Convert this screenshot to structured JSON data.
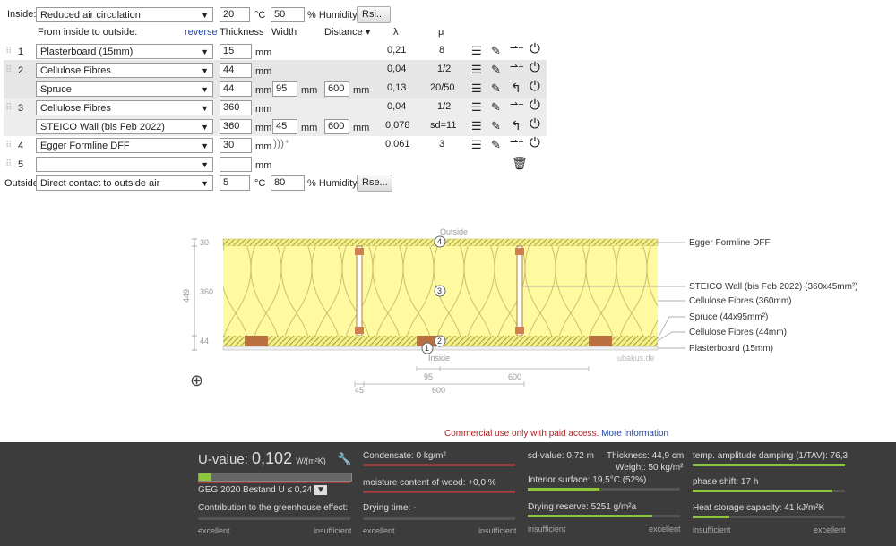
{
  "inside": {
    "label": "Inside:",
    "condition": "Reduced air circulation",
    "temp": "20",
    "temp_unit": "°C",
    "humidity": "50",
    "humidity_unit": "% Humidity",
    "button": "Rsi..."
  },
  "header": {
    "from": "From inside to outside:",
    "reverse": "reverse",
    "thickness": "Thickness",
    "width": "Width",
    "distance": "Distance ▾",
    "lambda": "λ",
    "mu": "μ"
  },
  "layers": [
    {
      "num": "1",
      "material": "Plasterboard (15mm)",
      "thickness": "15",
      "unit": "mm",
      "lambda": "0,21",
      "mu": "8"
    },
    {
      "num": "2",
      "material": "Cellulose Fibres",
      "thickness": "44",
      "unit": "mm",
      "lambda": "0,04",
      "mu": "1/2",
      "sub": {
        "material": "Spruce",
        "thickness": "44",
        "width": "95",
        "distance": "600",
        "unit": "mm",
        "lambda": "0,13",
        "mu": "20/50"
      }
    },
    {
      "num": "3",
      "material": "Cellulose Fibres",
      "thickness": "360",
      "unit": "mm",
      "lambda": "0,04",
      "mu": "1/2",
      "sub": {
        "material": "STEICO  Wall (bis Feb 2022)",
        "thickness": "360",
        "width": "45",
        "distance": "600",
        "unit": "mm",
        "lambda": "0,078",
        "mu": "sd=11"
      }
    },
    {
      "num": "4",
      "material": "Egger Formline DFF",
      "thickness": "30",
      "unit": "mm",
      "lambda": "0,061",
      "mu": "3"
    },
    {
      "num": "5",
      "material": "",
      "thickness": "",
      "unit": "mm"
    }
  ],
  "outside": {
    "label": "Outside",
    "condition": "Direct contact to outside air",
    "temp": "5",
    "temp_unit": "°C",
    "humidity": "80",
    "humidity_unit": "% Humidity",
    "button": "Rse..."
  },
  "diagram": {
    "outside": "Outside",
    "inside": "Inside",
    "total": "449",
    "credit": "ubakus.de",
    "t30": "30",
    "t360": "360",
    "t44": "44",
    "labels": [
      "Egger Formline DFF",
      "STEICO  Wall (bis Feb 2022) (360x45mm²)",
      "Cellulose Fibres (360mm)",
      "Spruce (44x95mm²)",
      "Cellulose Fibres (44mm)",
      "Plasterboard (15mm)"
    ],
    "markers": [
      "1",
      "2",
      "3",
      "4"
    ],
    "dim95": "95",
    "dim600a": "600",
    "dim45": "45",
    "dim600b": "600"
  },
  "notice": {
    "text": "Commercial use only with paid access.",
    "link": "More information"
  },
  "results": {
    "uvalue_label": "U-value:",
    "uvalue": "0,102",
    "uvalue_unit": "W/(m²K)",
    "standard": "GEG 2020 Bestand U ≤ 0,24",
    "greenhouse": "Contribution to the greenhouse effect:",
    "condensate": "Condensate: 0 kg/m²",
    "moisture": "moisture content of wood: +0,0 %",
    "drying_time": "Drying time: -",
    "sd": "sd-value: 0,72 m",
    "thickness": "Thickness: 44,9 cm",
    "weight": "Weight: 50 kg/m²",
    "interior": "Interior surface: 19,5°C (52%)",
    "drying_reserve": "Drying reserve: 5251 g/m²a",
    "temp_amp": "temp. amplitude damping (1/TAV): 76,3",
    "phase": "phase shift: 17 h",
    "heat": "Heat storage capacity: 41 kJ/m²K",
    "excellent": "excellent",
    "insufficient": "insufficient"
  }
}
